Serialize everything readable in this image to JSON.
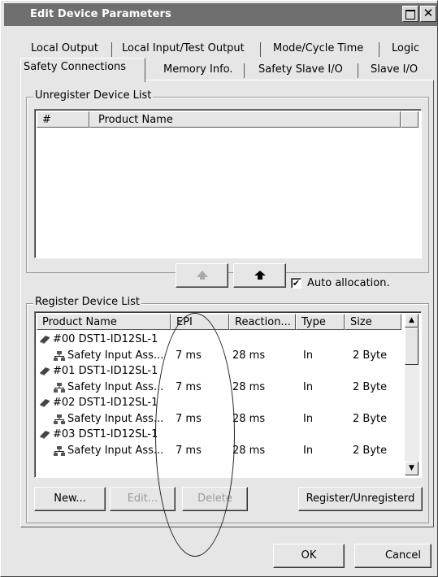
{
  "window": {
    "title": "Edit Device Parameters"
  },
  "tabs_row1": [
    {
      "label": "Local Output"
    },
    {
      "label": "Local Input/Test Output"
    },
    {
      "label": "Mode/Cycle Time"
    },
    {
      "label": "Logic"
    }
  ],
  "tabs_row2": [
    {
      "label": "Safety Connections",
      "active": true
    },
    {
      "label": "Memory Info."
    },
    {
      "label": "Safety Slave I/O"
    },
    {
      "label": "Slave I/O"
    }
  ],
  "unregister_list": {
    "group_label": "Unregister Device List",
    "columns": [
      "#",
      "Product Name"
    ],
    "rows": []
  },
  "move_up_icon": "arrow-up-icon",
  "move_down_icon": "arrow-down-icon",
  "auto_allocation": {
    "label": "Auto allocation.",
    "checked": true
  },
  "register_list": {
    "group_label": "Register Device List",
    "columns": [
      "Product Name",
      "EPI",
      "Reaction...",
      "Type",
      "Size"
    ],
    "rows": [
      {
        "kind": "device",
        "name": "#00 DST1-ID12SL-1"
      },
      {
        "kind": "connection",
        "name": "Safety Input Ass...",
        "epi": "7 ms",
        "reaction": "28 ms",
        "type": "In",
        "size": "2 Byte"
      },
      {
        "kind": "device",
        "name": "#01 DST1-ID12SL-1"
      },
      {
        "kind": "connection",
        "name": "Safety Input Ass...",
        "epi": "7 ms",
        "reaction": "28 ms",
        "type": "In",
        "size": "2 Byte"
      },
      {
        "kind": "device",
        "name": "#02 DST1-ID12SL-1"
      },
      {
        "kind": "connection",
        "name": "Safety Input Ass...",
        "epi": "7 ms",
        "reaction": "28 ms",
        "type": "In",
        "size": "2 Byte"
      },
      {
        "kind": "device",
        "name": "#03 DST1-ID12SL-1"
      },
      {
        "kind": "connection",
        "name": "Safety Input Ass...",
        "epi": "7 ms",
        "reaction": "28 ms",
        "type": "In",
        "size": "2 Byte"
      }
    ]
  },
  "buttons": {
    "new": "New...",
    "edit": "Edit...",
    "delete": "Delete",
    "register": "Register/Unregisterd",
    "ok": "OK",
    "cancel": "Cancel"
  },
  "colors": {
    "titlebar": "#6f6f6f",
    "face": "#e6e6e6"
  }
}
